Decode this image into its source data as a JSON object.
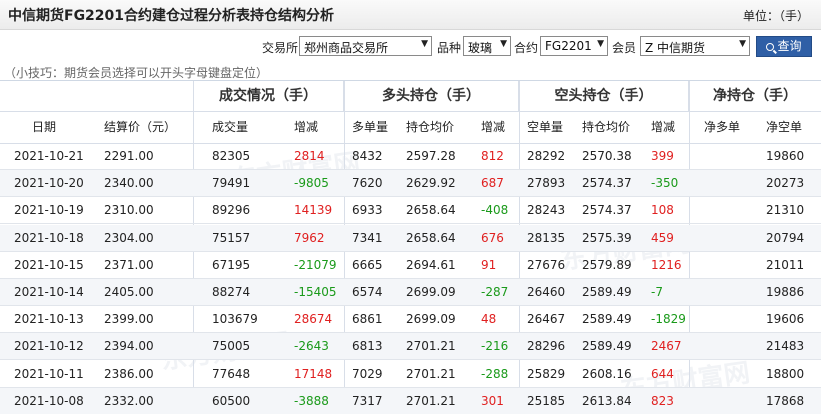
{
  "header": {
    "title": "中信期货FG2201合约建仓过程分析表持仓结构分析",
    "unit": "单位：（手）"
  },
  "filters": {
    "exchange_label": "交易所",
    "exchange_value": "郑州商品交易所",
    "variety_label": "品种",
    "variety_value": "玻璃",
    "contract_label": "合约",
    "contract_value": "FG2201",
    "member_label": "会员",
    "member_value": "Z 中信期货",
    "query_label": "查询"
  },
  "tip": "（小技巧：期货会员选择可以开头字母键盘定位）",
  "table": {
    "groups": [
      "成交情况（手）",
      "多头持仓（手）",
      "空头持仓（手）",
      "净持仓（手）"
    ],
    "columns": [
      "日期",
      "结算价（元）",
      "成交量",
      "增减",
      "多单量",
      "持仓均价",
      "增减",
      "空单量",
      "持仓均价",
      "增减",
      "净多单",
      "净空单"
    ],
    "rows": [
      [
        "2021-10-21",
        "2291.00",
        "82305",
        "2814",
        "8432",
        "2597.28",
        "812",
        "28292",
        "2570.38",
        "399",
        "",
        "19860"
      ],
      [
        "2021-10-20",
        "2340.00",
        "79491",
        "-9805",
        "7620",
        "2629.92",
        "687",
        "27893",
        "2574.37",
        "-350",
        "",
        "20273"
      ],
      [
        "2021-10-19",
        "2310.00",
        "89296",
        "14139",
        "6933",
        "2658.64",
        "-408",
        "28243",
        "2574.37",
        "108",
        "",
        "21310"
      ],
      [
        "2021-10-18",
        "2304.00",
        "75157",
        "7962",
        "7341",
        "2658.64",
        "676",
        "28135",
        "2575.39",
        "459",
        "",
        "20794"
      ],
      [
        "2021-10-15",
        "2371.00",
        "67195",
        "-21079",
        "6665",
        "2694.61",
        "91",
        "27676",
        "2579.89",
        "1216",
        "",
        "21011"
      ],
      [
        "2021-10-14",
        "2405.00",
        "88274",
        "-15405",
        "6574",
        "2699.09",
        "-287",
        "26460",
        "2589.49",
        "-7",
        "",
        "19886"
      ],
      [
        "2021-10-13",
        "2399.00",
        "103679",
        "28674",
        "6861",
        "2699.09",
        "48",
        "26467",
        "2589.49",
        "-1829",
        "",
        "19606"
      ],
      [
        "2021-10-12",
        "2394.00",
        "75005",
        "-2643",
        "6813",
        "2701.21",
        "-216",
        "28296",
        "2589.49",
        "2467",
        "",
        "21483"
      ],
      [
        "2021-10-11",
        "2386.00",
        "77648",
        "17148",
        "7029",
        "2701.21",
        "-288",
        "25829",
        "2608.16",
        "644",
        "",
        "18800"
      ],
      [
        "2021-10-08",
        "2332.00",
        "60500",
        "-3888",
        "7317",
        "2701.21",
        "301",
        "25185",
        "2613.84",
        "823",
        "",
        "17868"
      ]
    ]
  },
  "colors": {
    "increase": "#e02020",
    "decrease": "#1a9a1a",
    "query_button": "#2f5fa6"
  }
}
